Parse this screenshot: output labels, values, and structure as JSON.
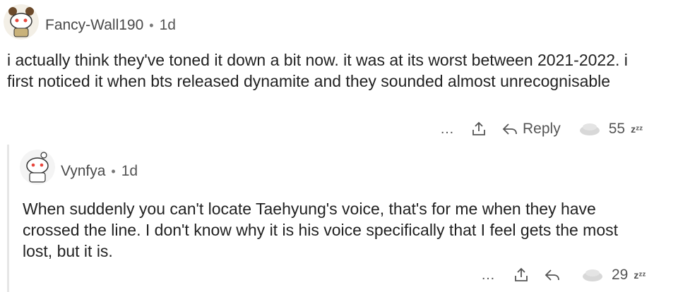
{
  "comments": [
    {
      "username": "Fancy-Wall190",
      "separator": "•",
      "age": "1d",
      "text": "i actually think they've toned it down a bit now. it was at its worst between 2021-2022. i first noticed it when bts released dynamite and they sounded almost unrecognisable",
      "actions": {
        "more": "…",
        "reply_label": "Reply",
        "votes": "55",
        "downvote_glyph": "zᶻᶻ"
      }
    },
    {
      "username": "Vynfya",
      "separator": "•",
      "age": "1d",
      "text": "When suddenly you can't locate Taehyung's voice, that's for me when they have crossed the line. I don't know why it is his voice specifically that I feel gets the most lost, but it is.",
      "actions": {
        "more": "…",
        "votes": "29",
        "downvote_glyph": "zᶻᶻ"
      }
    }
  ],
  "colors": {
    "text": "#222222",
    "meta": "#555555",
    "upvote_shape": "#d8d8d8",
    "thread_line": "#e6e6e6"
  },
  "icons": [
    "avatar",
    "more-icon",
    "share-icon",
    "reply-icon",
    "upvote-icon",
    "downvote-icon"
  ]
}
